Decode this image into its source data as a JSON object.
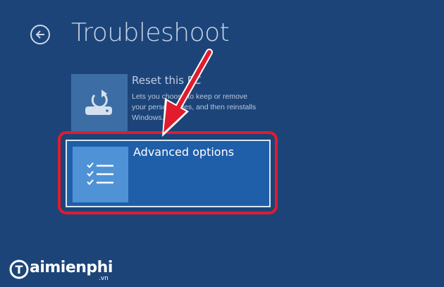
{
  "page": {
    "title": "Troubleshoot",
    "back_icon": "arrow-left-icon"
  },
  "tiles": [
    {
      "title": "Reset this PC",
      "description": "Lets you choose to keep or remove your personal files, and then reinstalls Windows.",
      "icon": "reset-pc-icon"
    },
    {
      "title": "Advanced options",
      "icon": "checklist-icon",
      "highlighted": true
    }
  ],
  "annotation": {
    "arrow_color": "#e21b2d",
    "frame_color": "#e21b2d"
  },
  "watermark": {
    "logo_text": "aimienphi",
    "logo_initial": "T",
    "suffix": ".vn"
  },
  "colors": {
    "background": "#1c4479",
    "tile_selected": "#1f5ea9",
    "icon_box": "#4f93d6"
  }
}
